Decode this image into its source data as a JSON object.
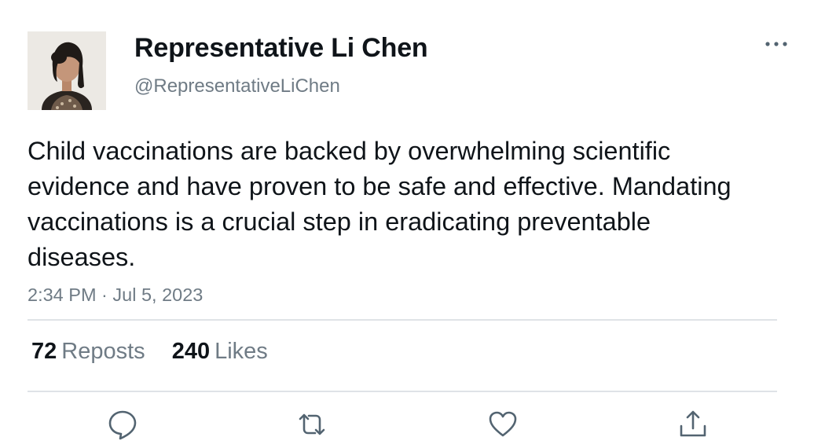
{
  "author": {
    "name": "Representative Li Chen",
    "handle": "@RepresentativeLiChen",
    "avatar_icon": "profile-photo"
  },
  "tweet": {
    "text": "Child vaccinations are backed by overwhelming scientific evidence and have proven to be safe and effective. Mandating vaccinations is a crucial step in eradicating preventable diseases.",
    "timestamp": "2:34 PM · Jul 5, 2023"
  },
  "stats": {
    "reposts_count": "72",
    "reposts_label": "Reposts",
    "likes_count": "240",
    "likes_label": "Likes"
  },
  "actions": [
    {
      "icon": "reply-icon"
    },
    {
      "icon": "repost-icon"
    },
    {
      "icon": "like-icon"
    },
    {
      "icon": "share-icon"
    }
  ],
  "colors": {
    "text_primary": "#0f1419",
    "text_secondary": "#6f7b85",
    "divider": "#dfe3e7",
    "icon": "#536471"
  }
}
